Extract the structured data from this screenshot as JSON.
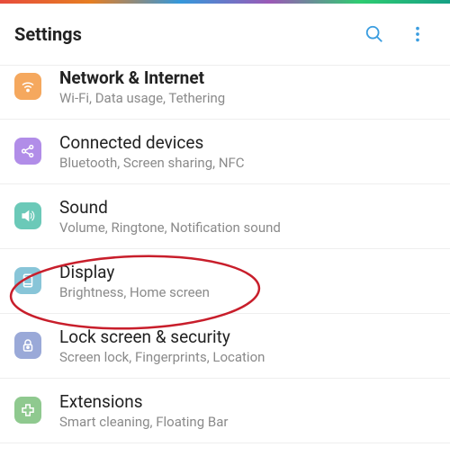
{
  "header": {
    "title": "Settings"
  },
  "rows": [
    {
      "title": "Network & Internet",
      "subtitle": "Wi-Fi, Data usage, Tethering",
      "icon": "wifi",
      "color": "#f5a85e"
    },
    {
      "title": "Connected devices",
      "subtitle": "Bluetooth, Screen sharing, NFC",
      "icon": "share",
      "color": "#b18de8"
    },
    {
      "title": "Sound",
      "subtitle": "Volume, Ringtone, Notification sound",
      "icon": "sound",
      "color": "#6bc9b8"
    },
    {
      "title": "Display",
      "subtitle": "Brightness, Home screen",
      "icon": "display",
      "color": "#88c5d8"
    },
    {
      "title": "Lock screen & security",
      "subtitle": "Screen lock, Fingerprints, Location",
      "icon": "lock",
      "color": "#9aa9d8"
    },
    {
      "title": "Extensions",
      "subtitle": "Smart cleaning, Floating Bar",
      "icon": "extension",
      "color": "#8fc98f"
    }
  ],
  "colors": {
    "search_icon": "#3a9de0",
    "more_icon": "#3a9de0"
  },
  "annotation": {
    "circled_row_index": 3,
    "stroke": "#c81e2b"
  }
}
